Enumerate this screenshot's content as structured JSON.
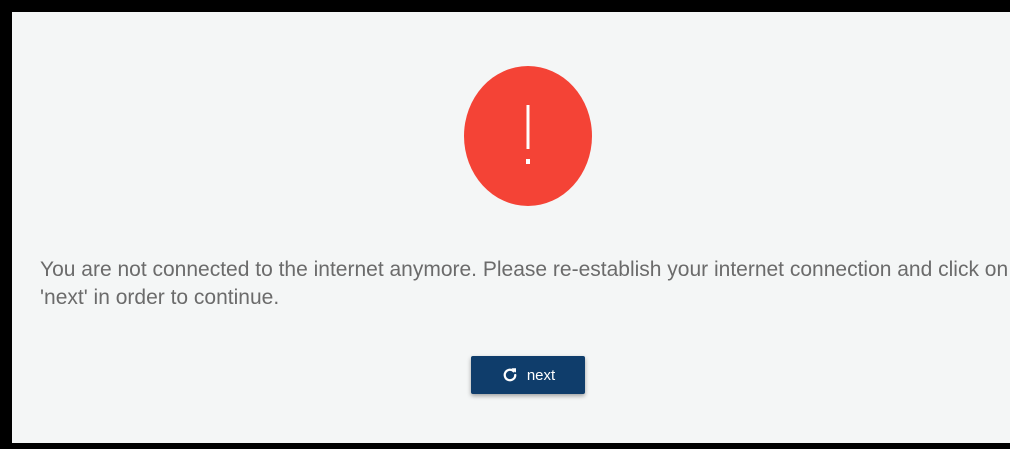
{
  "alert": {
    "icon": "exclamation-icon",
    "color": "#f44336"
  },
  "message": {
    "text": "You are not connected to the internet anymore. Please re-establish your internet connection and click on 'next' in order to continue."
  },
  "next_button": {
    "label": "next",
    "icon": "refresh-icon",
    "color": "#0f3d6b"
  },
  "colors": {
    "background": "#f4f6f6",
    "border": "#000000",
    "text": "#6b6b6b"
  }
}
